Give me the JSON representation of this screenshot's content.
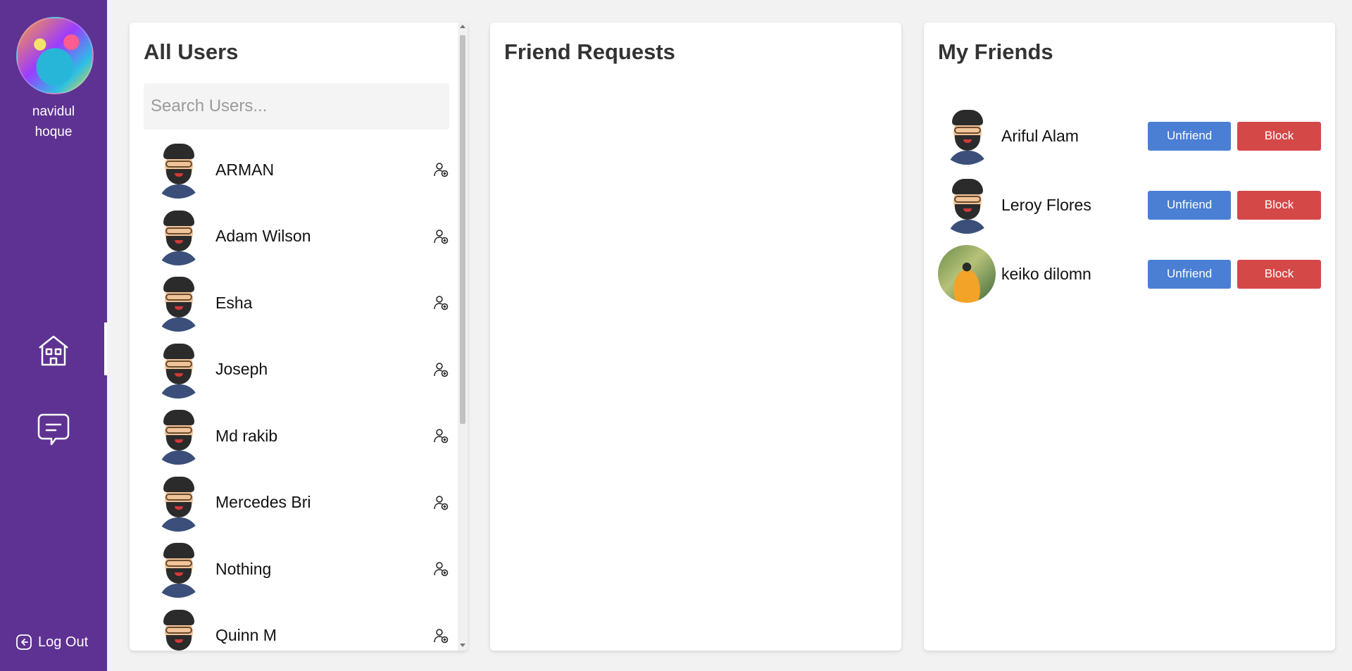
{
  "sidebar": {
    "profile_name": "navidul hoque",
    "nav": [
      {
        "name": "home-icon"
      },
      {
        "name": "chat-icon"
      }
    ],
    "logout_label": "Log Out"
  },
  "users_panel": {
    "title": "All Users",
    "search_placeholder": "Search Users...",
    "users": [
      {
        "name": "ARMAN"
      },
      {
        "name": "Adam Wilson"
      },
      {
        "name": "Esha"
      },
      {
        "name": "Joseph"
      },
      {
        "name": "Md rakib"
      },
      {
        "name": "Mercedes Bri"
      },
      {
        "name": "Nothing"
      },
      {
        "name": "Quinn M"
      }
    ]
  },
  "requests_panel": {
    "title": "Friend Requests"
  },
  "friends_panel": {
    "title": "My Friends",
    "unfriend_label": "Unfriend",
    "block_label": "Block",
    "friends": [
      {
        "name": "Ariful Alam",
        "avatar": "memoji"
      },
      {
        "name": "Leroy Flores",
        "avatar": "memoji"
      },
      {
        "name": "keiko dilomn",
        "avatar": "photo"
      }
    ]
  },
  "colors": {
    "sidebar_bg": "#5e3292",
    "unfriend_bg": "#4a7fd4",
    "block_bg": "#d44848"
  }
}
